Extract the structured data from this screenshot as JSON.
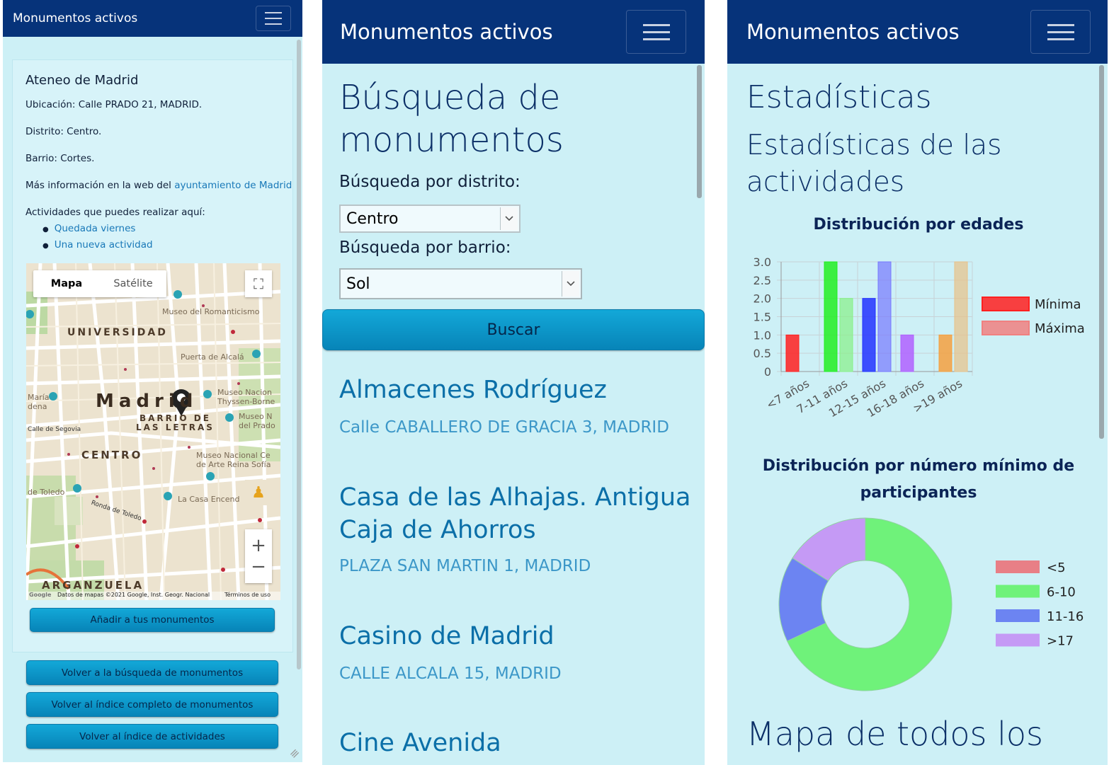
{
  "app_title": "Monumentos activos",
  "detail": {
    "name": "Ateneo de Madrid",
    "location": "Ubicación: Calle PRADO 21, MADRID.",
    "district": "Distrito: Centro.",
    "neighborhood": "Barrio: Cortes.",
    "more_info_prefix": "Más información en la web del ",
    "more_info_link": "ayuntamiento de Madrid",
    "activities_heading": "Actividades que puedes realizar aquí:",
    "activities": [
      "Quedada viernes",
      "Una nueva actividad"
    ],
    "map": {
      "tab_map": "Mapa",
      "tab_satellite": "Satélite",
      "labels": {
        "universidad": "UNIVERSIDAD",
        "madrid": "Madrid",
        "barrio": "BARRIO DE",
        "letras": "LAS LETRAS",
        "centro": "CENTRO",
        "arganzuela": "ARGANZUELA",
        "romanticismo": "Museo del Romanticismo",
        "alcala": "Puerta de Alcalá",
        "thyssen1": "Museo Nacion",
        "thyssen2": "Thyssen-Borne",
        "prado1": "Museo N",
        "prado2": "del Prado",
        "reina1": "Museo Nacional Ce",
        "reina2": "de Arte Reina Sofía",
        "encendida": "La Casa Encend",
        "toledo": "de Toledo",
        "segovia": "Calle de Segovia",
        "ronda": "Ronda de Toledo",
        "maria": "María",
        "dena": "dena",
        "credits": "Datos de mapas ©2021 Google, Inst. Geogr. Nacional",
        "terms": "Términos de uso",
        "google": "Google"
      }
    },
    "add_button": "Añadir a tus monumentos",
    "nav_buttons": [
      "Volver a la búsqueda de monumentos",
      "Volver al índice completo de monumentos",
      "Volver al índice de actividades"
    ]
  },
  "search": {
    "title_line1": "Búsqueda de",
    "title_line2": "monumentos",
    "district_label": "Búsqueda por distrito:",
    "district_value": "Centro",
    "barrio_label": "Búsqueda por barrio:",
    "barrio_value": "Sol",
    "search_button": "Buscar",
    "results": [
      {
        "name": "Almacenes Rodríguez",
        "address": "Calle CABALLERO DE GRACIA 3, MADRID"
      },
      {
        "name_line1": "Casa de las Alhajas. Antigua",
        "name_line2": "Caja de Ahorros",
        "address": "PLAZA SAN MARTIN 1, MADRID"
      },
      {
        "name": "Casino de Madrid",
        "address": "CALLE ALCALA 15, MADRID"
      },
      {
        "name": "Cine Avenida"
      }
    ]
  },
  "stats": {
    "title": "Estadísticas",
    "subtitle_line1": "Estadísticas de las",
    "subtitle_line2": "actividades",
    "footer_heading": "Mapa de todos los"
  },
  "chart_data": [
    {
      "type": "bar",
      "title": "Distribución por edades",
      "categories": [
        "<7 años",
        "7-11 años",
        "12-15 años",
        "16-18 años",
        ">19 años"
      ],
      "series": [
        {
          "name": "Mínima",
          "values": [
            1,
            3,
            2,
            1,
            1
          ]
        },
        {
          "name": "Máxima",
          "values": [
            0,
            2,
            3,
            0,
            3
          ]
        }
      ],
      "bar_colors_min": [
        "#ff2020",
        "#22ee22",
        "#2233ff",
        "#b060ff",
        "#f5a040"
      ],
      "bar_colors_max": [
        "#f08080",
        "#88f088",
        "#7777ff",
        "#c890ff",
        "#e8c088"
      ],
      "ylim": [
        0,
        3
      ],
      "yticks": [
        "3.0",
        "2.5",
        "2.0",
        "1.5",
        "1.0",
        "0.5",
        "0"
      ],
      "legend_position": "right",
      "grid": true
    },
    {
      "type": "pie",
      "title_line1": "Distribución por número mínimo de",
      "title_line2": "participantes",
      "labels": [
        "<5",
        "6-10",
        "11-16",
        ">17"
      ],
      "values": [
        0,
        68,
        16,
        16
      ],
      "colors": [
        "#e87f86",
        "#6ff27a",
        "#6c84f2",
        "#c59af5"
      ],
      "legend_position": "right"
    }
  ]
}
